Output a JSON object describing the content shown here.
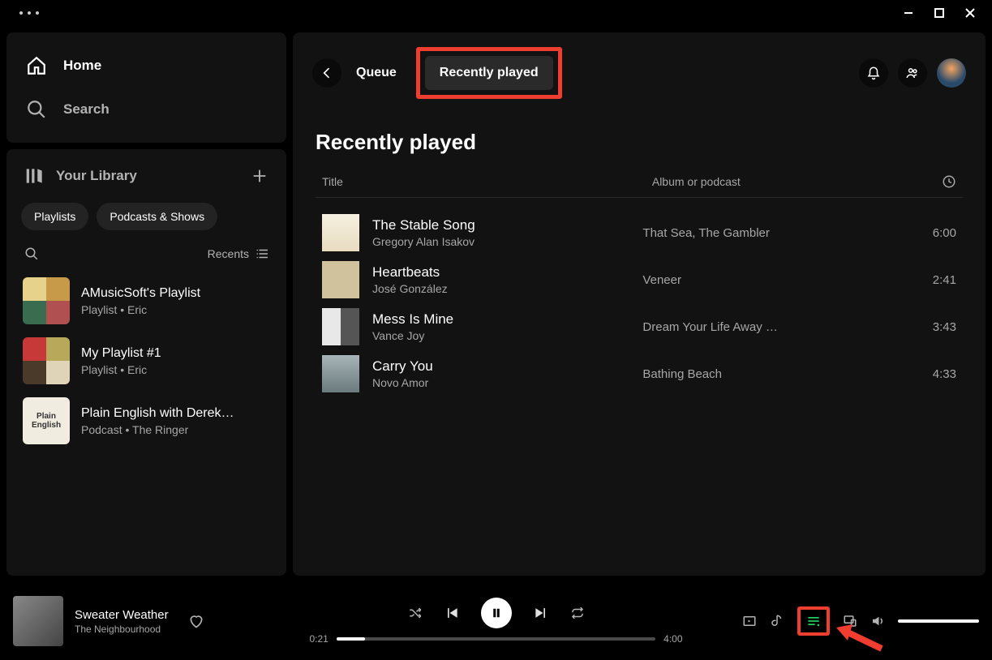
{
  "sidebar": {
    "home": "Home",
    "search": "Search",
    "library_title": "Your Library",
    "filters": [
      "Playlists",
      "Podcasts & Shows"
    ],
    "sort_label": "Recents",
    "items": [
      {
        "title": "AMusicSoft's Playlist",
        "subtitle": "Playlist • Eric"
      },
      {
        "title": "My Playlist #1",
        "subtitle": "Playlist • Eric"
      },
      {
        "title": "Plain English with Derek…",
        "subtitle": "Podcast • The Ringer"
      }
    ]
  },
  "header": {
    "queue_tab": "Queue",
    "recent_tab": "Recently played"
  },
  "section_heading": "Recently played",
  "table": {
    "col_title": "Title",
    "col_album": "Album or podcast"
  },
  "tracks": [
    {
      "title": "The Stable Song",
      "artist": "Gregory Alan Isakov",
      "album": "That Sea, The Gambler",
      "duration": "6:00"
    },
    {
      "title": "Heartbeats",
      "artist": "José González",
      "album": "Veneer",
      "duration": "2:41"
    },
    {
      "title": "Mess Is Mine",
      "artist": "Vance Joy",
      "album": "Dream Your Life Away …",
      "duration": "3:43"
    },
    {
      "title": "Carry You",
      "artist": "Novo Amor",
      "album": "Bathing Beach",
      "duration": "4:33"
    }
  ],
  "now_playing": {
    "title": "Sweater Weather",
    "artist": "The Neighbourhood",
    "position": "0:21",
    "duration": "4:00"
  },
  "podcast_art_text": "Plain English"
}
